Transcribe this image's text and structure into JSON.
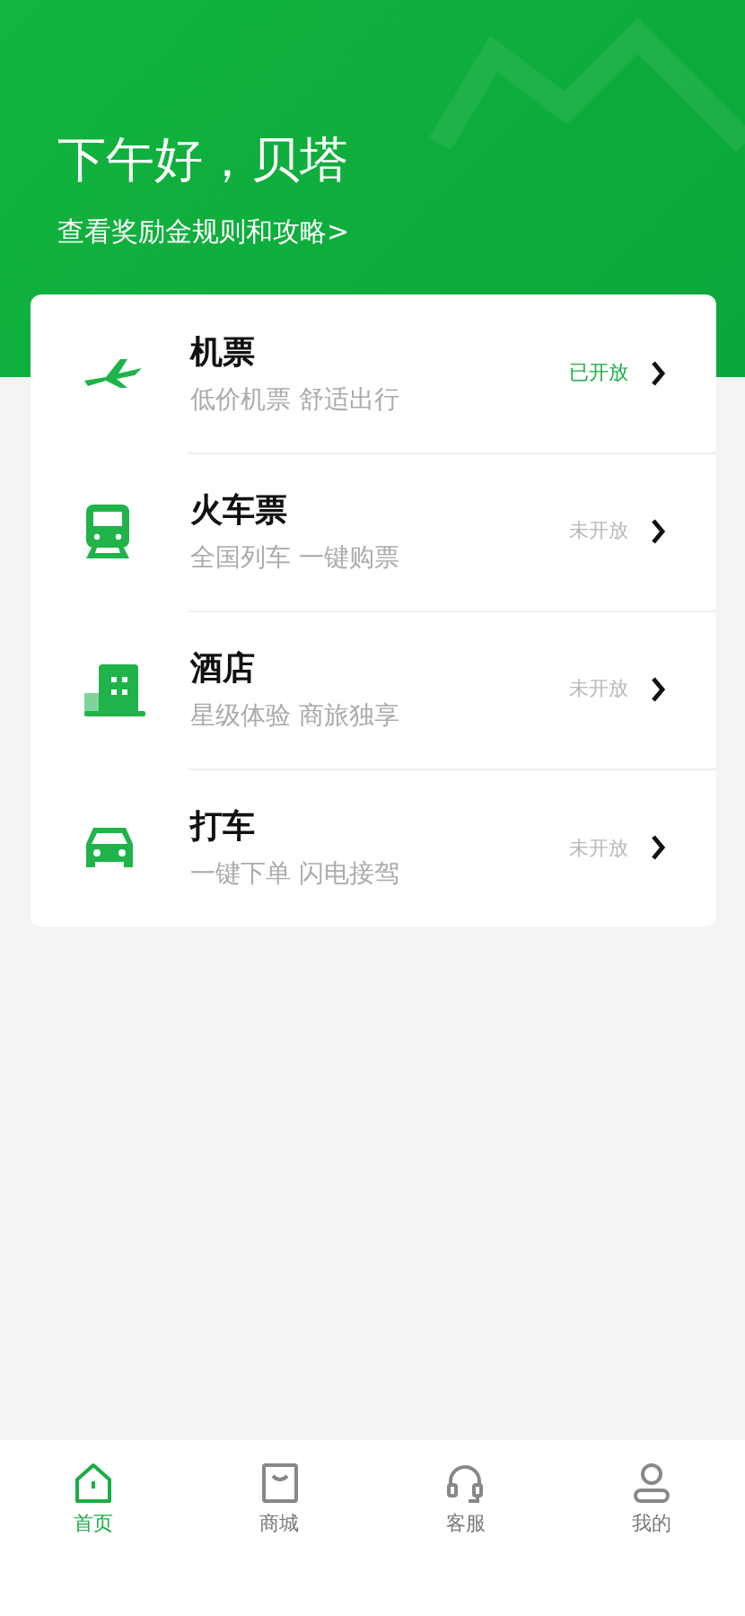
{
  "header": {
    "greeting": "下午好，贝塔",
    "rules_link": "查看奖励金规则和攻略>"
  },
  "services": [
    {
      "kind": "plane",
      "title": "机票",
      "subtitle": "低价机票 舒适出行",
      "status": "已开放",
      "open": true
    },
    {
      "kind": "train",
      "title": "火车票",
      "subtitle": "全国列车 一键购票",
      "status": "未开放",
      "open": false
    },
    {
      "kind": "hotel",
      "title": "酒店",
      "subtitle": "星级体验 商旅独享",
      "status": "未开放",
      "open": false
    },
    {
      "kind": "car",
      "title": "打车",
      "subtitle": "一键下单 闪电接驾",
      "status": "未开放",
      "open": false
    }
  ],
  "tabs": [
    {
      "kind": "home",
      "label": "首页",
      "selected": true
    },
    {
      "kind": "shop",
      "label": "商城",
      "selected": false
    },
    {
      "kind": "service",
      "label": "客服",
      "selected": false
    },
    {
      "kind": "profile",
      "label": "我的",
      "selected": false
    }
  ]
}
